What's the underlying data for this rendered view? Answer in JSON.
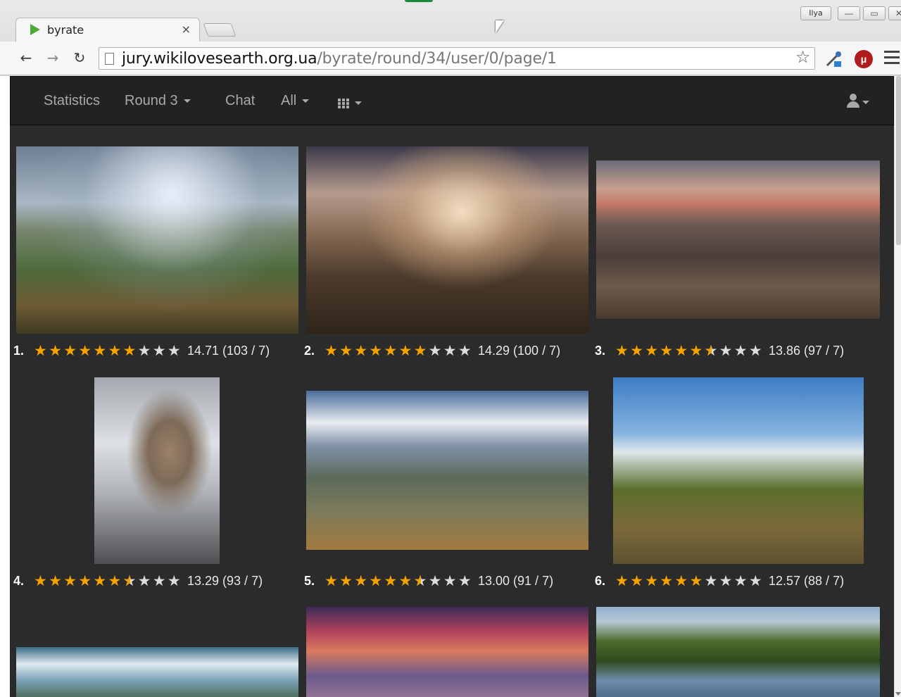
{
  "browser": {
    "tab_title": "byrate",
    "tab_close": "×",
    "profile_badge": "Ilya",
    "url_domain": "jury.wikilovesearth.org.ua",
    "url_path": "/byrate/round/34/user/0/page/1",
    "back_glyph": "←",
    "forward_glyph": "→",
    "reload_glyph": "↻",
    "bookmark_glyph": "☆",
    "ublock_glyph": "μ",
    "minimize_glyph": "—",
    "maximize_glyph": "▭",
    "close_glyph": "✕",
    "accent_color": "#1d8a3a"
  },
  "navbar": {
    "statistics": "Statistics",
    "round": "Round 3",
    "chat": "Chat",
    "filter": "All",
    "icons": [
      "grid-icon",
      "user-icon"
    ]
  },
  "photos": [
    {
      "rank": "1.",
      "stars_full": 7,
      "stars_half": false,
      "score": "14.71 (103 / 7)"
    },
    {
      "rank": "2.",
      "stars_full": 7,
      "stars_half": false,
      "score": "14.29 (100 / 7)"
    },
    {
      "rank": "3.",
      "stars_full": 6,
      "stars_half": true,
      "score": "13.86 (97 / 7)"
    },
    {
      "rank": "4.",
      "stars_full": 6,
      "stars_half": true,
      "score": "13.29 (93 / 7)"
    },
    {
      "rank": "5.",
      "stars_full": 6,
      "stars_half": true,
      "score": "13.00 (91 / 7)"
    },
    {
      "rank": "6.",
      "stars_full": 6,
      "stars_half": false,
      "score": "12.57 (88 / 7)"
    }
  ],
  "star_color": "#f5a300"
}
